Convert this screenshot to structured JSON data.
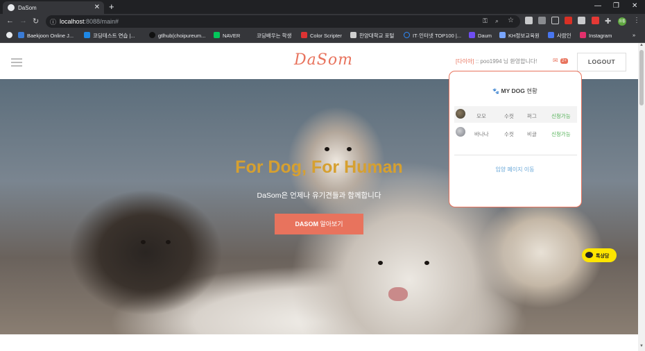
{
  "browser": {
    "tab_title": "DaSom",
    "tab_close": "✕",
    "new_tab": "+",
    "url_host": "localhost",
    "url_path": ":8088/main#",
    "profile_initials": "유통",
    "window_controls": [
      "—",
      "❐",
      "✕"
    ],
    "bookmarks": [
      {
        "label": "Baekjoon Online J...",
        "icon": "baekjoon-icon",
        "color": "#3a7bd5"
      },
      {
        "label": "코딩테스트 연습 |...",
        "icon": "programmers-icon",
        "color": "#1e88e5"
      },
      {
        "label": "gtlhub(choipureum...",
        "icon": "github-icon",
        "color": "#111111"
      },
      {
        "label": "NAVER",
        "icon": "naver-icon",
        "color": "#03c75a"
      },
      {
        "label": "코딩배우는 학생",
        "icon": "blog-icon",
        "color": "#35363a"
      },
      {
        "label": "Color Scripter",
        "icon": "color-scripter-icon",
        "color": "#d33"
      },
      {
        "label": "한양대학교 포털",
        "icon": "university-icon",
        "color": "#cfcfcf"
      },
      {
        "label": "IT·인터넷 TOP100 |...",
        "icon": "top100-icon",
        "color": "#2d8cff"
      },
      {
        "label": "Daum",
        "icon": "daum-icon",
        "color": "#6f4ef2"
      },
      {
        "label": "KH정보교육원",
        "icon": "kh-icon",
        "color": "#7aa6ff"
      },
      {
        "label": "사람인",
        "icon": "saramin-icon",
        "color": "#4876ef"
      },
      {
        "label": "Instagram",
        "icon": "instagram-icon",
        "color": "#e1306c"
      }
    ],
    "bookmarks_more": "»"
  },
  "header": {
    "logo": "DaSom",
    "grade": "[다이아]",
    "greeting": " :: poo1994 님 환영합니다!",
    "message_count": "2+",
    "logout_label": "LOGOUT"
  },
  "hero": {
    "title": "For Dog, For Human",
    "subtitle": "DaSom은 언제나 유기견들과 함께합니다",
    "button_bold": "DASOM",
    "button_rest": " 알아보기"
  },
  "dropdown": {
    "title_bold": "MY DOG",
    "title_rest": " 현황",
    "rows": [
      {
        "name": "모모",
        "sex": "수컷",
        "breed": "퍼그",
        "status": "신청가능"
      },
      {
        "name": "바나나",
        "sex": "수컷",
        "breed": "비글",
        "status": "신청가능"
      }
    ],
    "link": "입양 페이지 이동"
  },
  "chat": {
    "label": "톡상담"
  },
  "colors": {
    "accent": "#e8735d",
    "hero_title": "#d6a030",
    "status_ok": "#4caf50",
    "link": "#6aa8d8"
  }
}
